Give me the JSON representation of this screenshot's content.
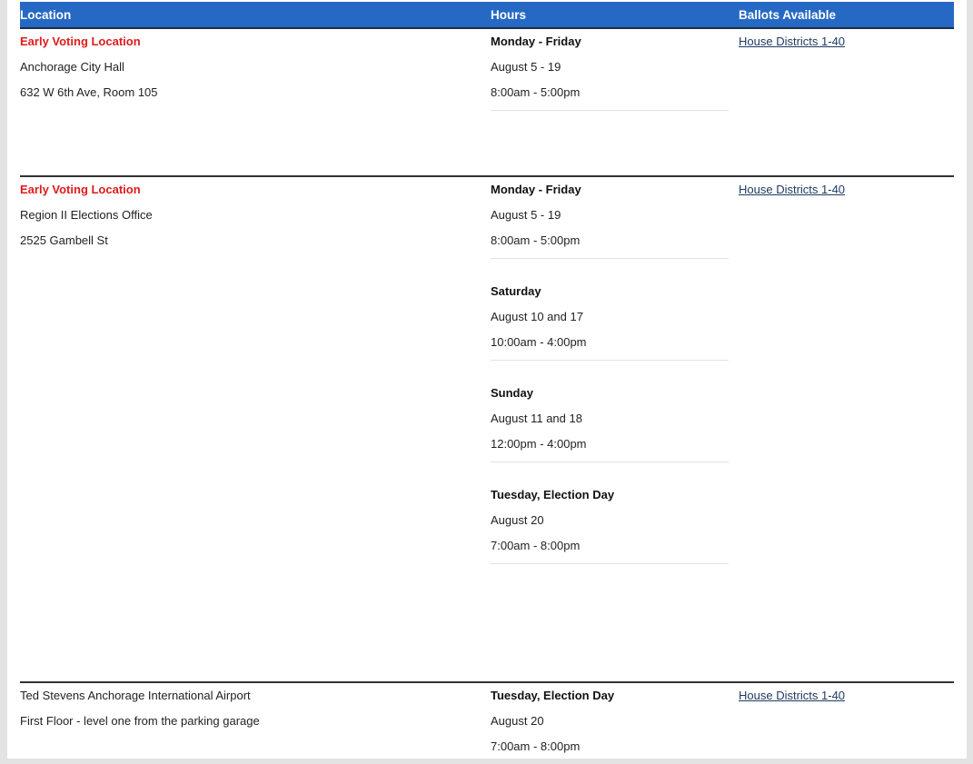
{
  "table": {
    "headers": {
      "location": "Location",
      "hours": "Hours",
      "ballots": "Ballots Available"
    },
    "rows": [
      {
        "type": "Early Voting Location",
        "name": "Anchorage City Hall",
        "address": "632 W 6th Ave, Room 105",
        "ballots_link": "House Districts 1-40",
        "hours": [
          {
            "day": "Monday - Friday",
            "dates": "August 5 - 19",
            "time": "8:00am - 5:00pm"
          }
        ]
      },
      {
        "type": "Early Voting Location",
        "name": "Region II Elections Office",
        "address": "2525 Gambell St",
        "ballots_link": "House Districts 1-40",
        "hours": [
          {
            "day": "Monday - Friday",
            "dates": "August 5 - 19",
            "time": "8:00am - 5:00pm"
          },
          {
            "day": "Saturday",
            "dates": "August 10 and 17",
            "time": "10:00am - 4:00pm"
          },
          {
            "day": "Sunday",
            "dates": "August 11 and 18",
            "time": "12:00pm - 4:00pm"
          },
          {
            "day": "Tuesday, Election Day",
            "dates": "August 20",
            "time": "7:00am - 8:00pm"
          }
        ]
      },
      {
        "name": "Ted Stevens Anchorage International Airport",
        "address": "First Floor - level one from the parking garage",
        "ballots_link": "House Districts 1-40",
        "hours": [
          {
            "day": "Tuesday, Election Day",
            "dates": "August 20",
            "time": "7:00am - 8:00pm"
          }
        ]
      }
    ]
  },
  "colors": {
    "header_bg": "#2669c4",
    "location_type": "#e01b1b",
    "link": "#1f3a60"
  }
}
